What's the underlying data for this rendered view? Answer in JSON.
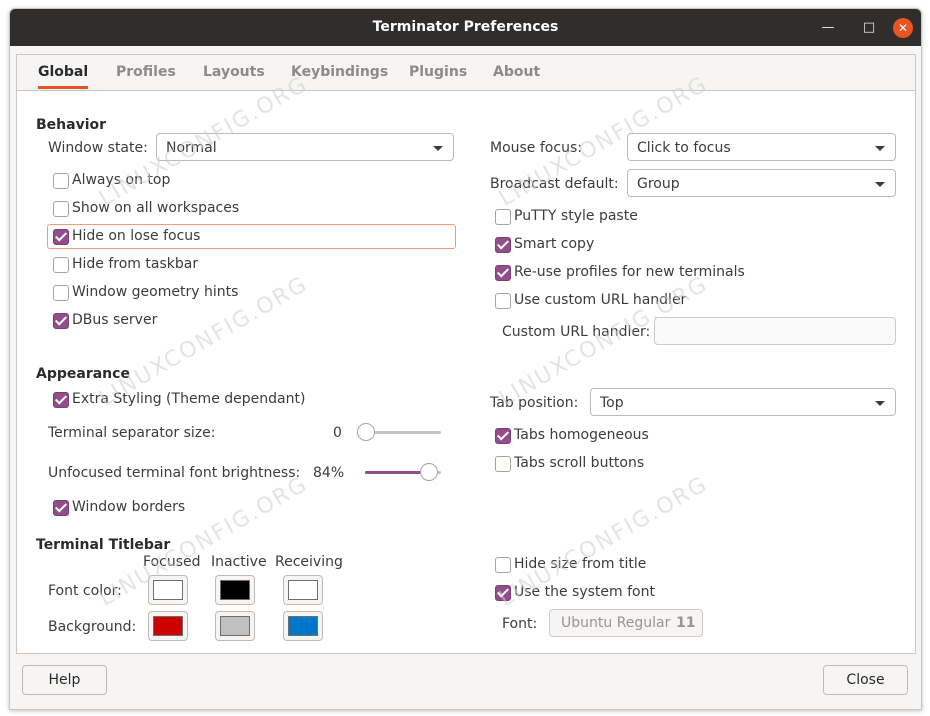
{
  "window": {
    "title": "Terminator Preferences"
  },
  "tabs": [
    "Global",
    "Profiles",
    "Layouts",
    "Keybindings",
    "Plugins",
    "About"
  ],
  "behavior": {
    "heading": "Behavior",
    "window_state_label": "Window state:",
    "window_state_value": "Normal",
    "checkboxes": [
      {
        "label": "Always on top",
        "checked": false
      },
      {
        "label": "Show on all workspaces",
        "checked": false
      },
      {
        "label": "Hide on lose focus",
        "checked": true
      },
      {
        "label": "Hide from taskbar",
        "checked": false
      },
      {
        "label": "Window geometry hints",
        "checked": false
      },
      {
        "label": "DBus server",
        "checked": true
      }
    ]
  },
  "right_behavior": {
    "mouse_focus_label": "Mouse focus:",
    "mouse_focus_value": "Click to focus",
    "broadcast_label": "Broadcast default:",
    "broadcast_value": "Group",
    "checkboxes": [
      {
        "label": "PuTTY style paste",
        "checked": false
      },
      {
        "label": "Smart copy",
        "checked": true
      },
      {
        "label": "Re-use profiles for new terminals",
        "checked": true
      },
      {
        "label": "Use custom URL handler",
        "checked": false
      }
    ],
    "url_handler_label": "Custom URL handler:",
    "url_handler_value": ""
  },
  "appearance": {
    "heading": "Appearance",
    "extra_styling": {
      "label": "Extra Styling (Theme dependant)",
      "checked": true
    },
    "separator_label": "Terminal separator size:",
    "separator_value": "0",
    "separator_fraction": 0.0,
    "brightness_label": "Unfocused terminal font brightness:",
    "brightness_value": "84%",
    "brightness_fraction": 0.84,
    "window_borders": {
      "label": "Window borders",
      "checked": true
    },
    "tab_position_label": "Tab position:",
    "tab_position_value": "Top",
    "tabs_homogeneous": {
      "label": "Tabs homogeneous",
      "checked": true
    },
    "tabs_scroll": {
      "label": "Tabs scroll buttons",
      "checked": false
    }
  },
  "titlebar": {
    "heading": "Terminal Titlebar",
    "columns": [
      "Focused",
      "Inactive",
      "Receiving"
    ],
    "font_color_label": "Font color:",
    "background_label": "Background:",
    "font_colors": [
      "#ffffff",
      "#000000",
      "#ffffff"
    ],
    "backgrounds": [
      "#cc0000",
      "#c0c0c0",
      "#0076c9"
    ],
    "hide_size": {
      "label": "Hide size from title",
      "checked": false
    },
    "system_font": {
      "label": "Use the system font",
      "checked": true
    },
    "font_label": "Font:",
    "font_name": "Ubuntu Regular",
    "font_size": "11"
  },
  "buttons": {
    "help": "Help",
    "close": "Close"
  },
  "watermark": "LINUXCONFIG.ORG",
  "colors": {
    "accent": "#e95420",
    "check": "#924d8b",
    "titlebar": "#302e2c"
  }
}
